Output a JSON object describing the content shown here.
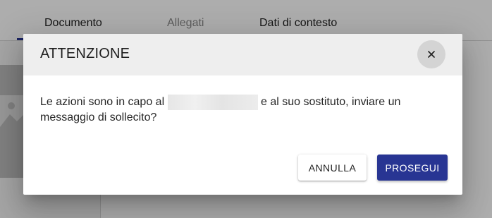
{
  "background": {
    "tabs": [
      {
        "label": "Documento",
        "active": true
      },
      {
        "label": "Allegati",
        "active": false
      },
      {
        "label": "Dati di contesto",
        "active": false
      }
    ]
  },
  "dialog": {
    "title": "ATTENZIONE",
    "close_icon": "close-icon",
    "message_before": "Le azioni sono in capo al ",
    "message_after": " e al suo sostituto, inviare un messaggio di sollecito?",
    "cancel_label": "ANNULLA",
    "confirm_label": "PROSEGUI"
  },
  "colors": {
    "primary": "#283593",
    "header_bg": "#eeeeee",
    "overlay": "rgba(0,0,0,0.32)"
  }
}
